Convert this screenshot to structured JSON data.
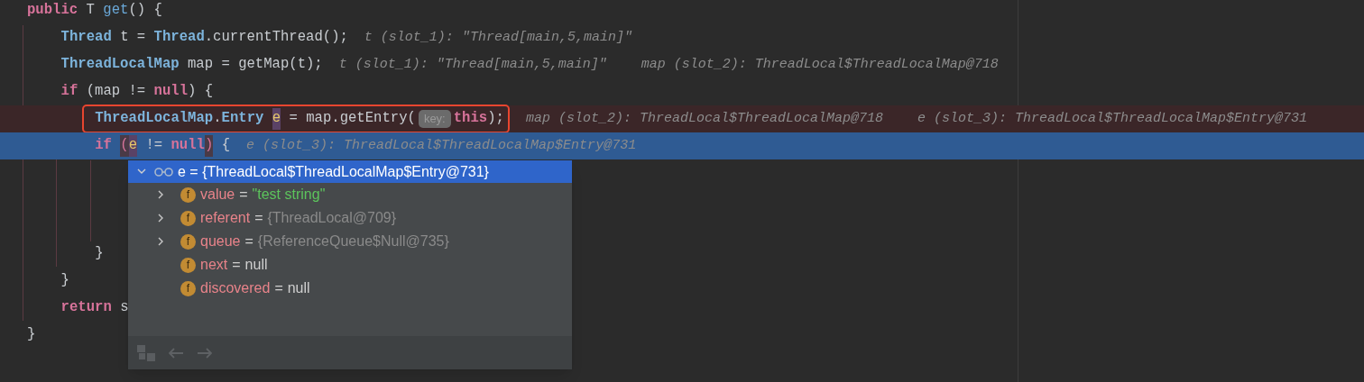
{
  "code_lines": [
    {
      "breakpoint": false,
      "current": false,
      "tokens": [
        {
          "kind": "keyword",
          "text": "public"
        },
        {
          "kind": "plain",
          "text": "T"
        },
        {
          "kind": "method",
          "text": "get"
        },
        {
          "kind": "plain",
          "text": "() {",
          "attached": true
        }
      ],
      "children": [
        {
          "breakpoint": false,
          "current": false,
          "tokens": [
            {
              "kind": "type",
              "text": "Thread"
            },
            {
              "kind": "plain",
              "text": "t ="
            },
            {
              "kind": "type",
              "text": "Thread"
            },
            {
              "kind": "plain",
              "text": ".currentThread();",
              "attached": true
            }
          ],
          "hints": [
            "t (slot_1): \"Thread[main,5,main]\""
          ]
        },
        {
          "breakpoint": false,
          "current": false,
          "tokens": [
            {
              "kind": "type",
              "text": "ThreadLocalMap"
            },
            {
              "kind": "plain",
              "text": "map = getMap(t);"
            }
          ],
          "hints": [
            "t (slot_1): \"Thread[main,5,main]\"",
            "map (slot_2): ThreadLocal$ThreadLocalMap@718"
          ]
        },
        {
          "breakpoint": false,
          "current": false,
          "tokens": [
            {
              "kind": "keyword",
              "text": "if"
            },
            {
              "kind": "plain",
              "text": "(map !="
            },
            {
              "kind": "keyword",
              "text": "null"
            },
            {
              "kind": "plain",
              "text": ") {",
              "attached": true
            }
          ],
          "children": [
            {
              "breakpoint": true,
              "current": false,
              "outlined": true,
              "tokens": [
                {
                  "kind": "type",
                  "text": "ThreadLocalMap"
                },
                {
                  "kind": "plain",
                  "text": ".",
                  "attached": true
                },
                {
                  "kind": "type",
                  "text": "Entry",
                  "attached": true
                },
                {
                  "kind": "usage",
                  "text": "e"
                },
                {
                  "kind": "plain",
                  "text": "= map.getEntry("
                },
                {
                  "kind": "inlay",
                  "text": "key:",
                  "attached": true
                },
                {
                  "kind": "keyword",
                  "text": "this",
                  "attached": true
                },
                {
                  "kind": "plain",
                  "text": ");",
                  "attached": true
                }
              ],
              "hints": [
                "map (slot_2): ThreadLocal$ThreadLocalMap@718",
                "e (slot_3): ThreadLocal$ThreadLocalMap$Entry@731"
              ]
            },
            {
              "breakpoint": false,
              "current": true,
              "tokens": [
                {
                  "kind": "keyword",
                  "text": "if"
                },
                {
                  "kind": "brace",
                  "text": "("
                },
                {
                  "kind": "usage",
                  "text": "e",
                  "attached": true
                },
                {
                  "kind": "plain",
                  "text": "!="
                },
                {
                  "kind": "keyword",
                  "text": "null"
                },
                {
                  "kind": "brace",
                  "text": ")",
                  "attached": true
                },
                {
                  "kind": "plain",
                  "text": "{"
                }
              ],
              "hints": [
                "e (slot_3): ThreadLocal$ThreadLocalMap$Entry@731"
              ],
              "children": [
                {
                  "breakpoint": false,
                  "current": false
                },
                {
                  "breakpoint": false,
                  "current": false
                },
                {
                  "breakpoint": false,
                  "current": false
                }
              ]
            },
            {
              "breakpoint": false,
              "current": false,
              "tokens": [
                {
                  "kind": "plain",
                  "text": "}"
                }
              ]
            }
          ]
        },
        {
          "breakpoint": false,
          "current": false,
          "tokens": [
            {
              "kind": "plain",
              "text": "}"
            }
          ]
        },
        {
          "breakpoint": false,
          "current": false,
          "tokens": [
            {
              "kind": "keyword",
              "text": "return"
            },
            {
              "kind": "plain",
              "text": "s"
            }
          ]
        }
      ]
    },
    {
      "breakpoint": false,
      "current": false,
      "tokens": [
        {
          "kind": "plain",
          "text": "}"
        }
      ]
    }
  ],
  "popup": {
    "header": {
      "text": "e = {ThreadLocal$ThreadLocalMap$Entry@731}",
      "expanded": true,
      "selected": true
    },
    "fields": [
      {
        "badge": "f",
        "name": "value",
        "separator": "=",
        "value": "\"test string\"",
        "kind": "string",
        "expandable": true
      },
      {
        "badge": "f",
        "name": "referent",
        "separator": "=",
        "value": "{ThreadLocal@709}",
        "kind": "object",
        "expandable": true
      },
      {
        "badge": "f",
        "name": "queue",
        "separator": "=",
        "value": "{ReferenceQueue$Null@735}",
        "kind": "object",
        "expandable": true
      },
      {
        "badge": "f",
        "name": "next",
        "separator": "=",
        "value": "null",
        "kind": "null",
        "expandable": false
      },
      {
        "badge": "f",
        "name": "discovered",
        "separator": "=",
        "value": "null",
        "kind": "null",
        "expandable": false
      }
    ]
  }
}
